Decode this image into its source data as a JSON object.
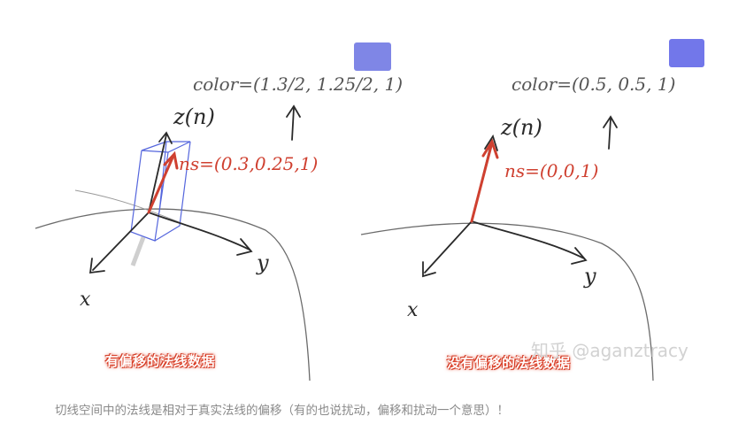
{
  "diagram": {
    "left": {
      "color_label": "color=(1.3/2, 1.25/2, 1)",
      "axis_z": "z(n)",
      "normal_label": "ns=(0.3,0.25,1)",
      "axis_x": "x",
      "axis_y": "y",
      "caption_label": "有偏移的法线数据",
      "swatch_color": "#7f86e6"
    },
    "right": {
      "color_label": "color=(0.5, 0.5, 1)",
      "axis_z": "z(n)",
      "normal_label": "ns=(0,0,1)",
      "axis_x": "x",
      "axis_y": "y",
      "caption_label": "没有偏移的法线数据",
      "swatch_color": "#7277ea"
    }
  },
  "watermark": "知乎 @aganztracy",
  "caption": "切线空间中的法线是相对于真实法线的偏移（有的也说扰动，偏移和扰动一个意思）！",
  "colors": {
    "normal_red": "#cf4030",
    "pencil": "#333333",
    "box_blue": "#5566dd",
    "label_red": "#e0422a"
  }
}
